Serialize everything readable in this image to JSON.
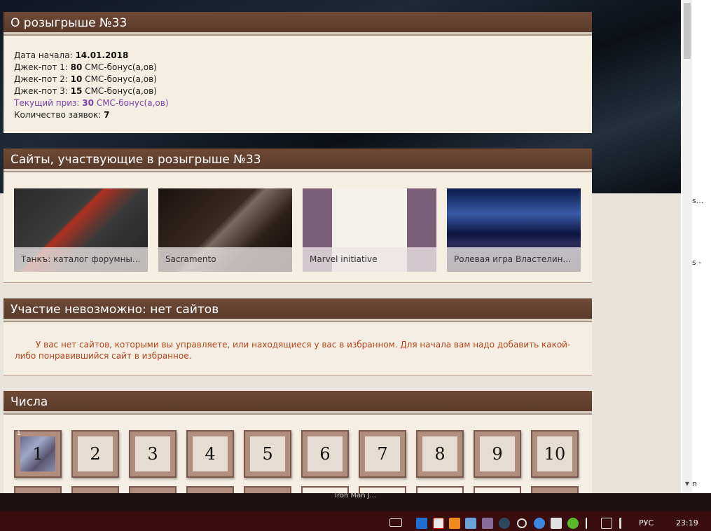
{
  "raffle": {
    "title": "О розыгрыше №33",
    "start_label": "Дата начала:",
    "start_date": "14.01.2018",
    "jackpots": [
      {
        "label": "Джек-пот 1:",
        "value": "80",
        "unit": "СМС-бонус(а,ов)"
      },
      {
        "label": "Джек-пот 2:",
        "value": "10",
        "unit": "СМС-бонус(а,ов)"
      },
      {
        "label": "Джек-пот 3:",
        "value": "15",
        "unit": "СМС-бонус(а,ов)"
      }
    ],
    "current_prize_label": "Текущий приз:",
    "current_prize_value": "30",
    "current_prize_unit": "СМС-бонус(а,ов)",
    "entries_label": "Количество заявок:",
    "entries_value": "7"
  },
  "sites_panel": {
    "title": "Сайты, участвующие в розыгрыше №33",
    "sites": [
      {
        "name": "Танкъ: каталог форумны..."
      },
      {
        "name": "Sacramento"
      },
      {
        "name": "Marvel initiative"
      },
      {
        "name": "Ролевая игра Властелин..."
      }
    ]
  },
  "participation": {
    "title": "Участие невозможно: нет сайтов",
    "message": "У вас нет сайтов, которыми вы управляете, или находящиеся у вас в избранном. Для начала вам надо добавить какой-либо понравившийся сайт в избранное."
  },
  "numbers_panel": {
    "title": "Числа",
    "numbers": [
      "1",
      "2",
      "3",
      "4",
      "5",
      "6",
      "7",
      "8",
      "9",
      "10"
    ],
    "first_badge": "1"
  },
  "right_clip": {
    "a": "s...",
    "b": "s -",
    "c": "n"
  },
  "taskbar": {
    "tooltip": "Iron Man J...",
    "lang": "РУС",
    "time": "23:19"
  },
  "colors": {
    "header_bg": "#5a3a2a",
    "panel_bg": "#f4efe2",
    "prize_text": "#7b3fb0",
    "warning_text": "#b5431c"
  }
}
